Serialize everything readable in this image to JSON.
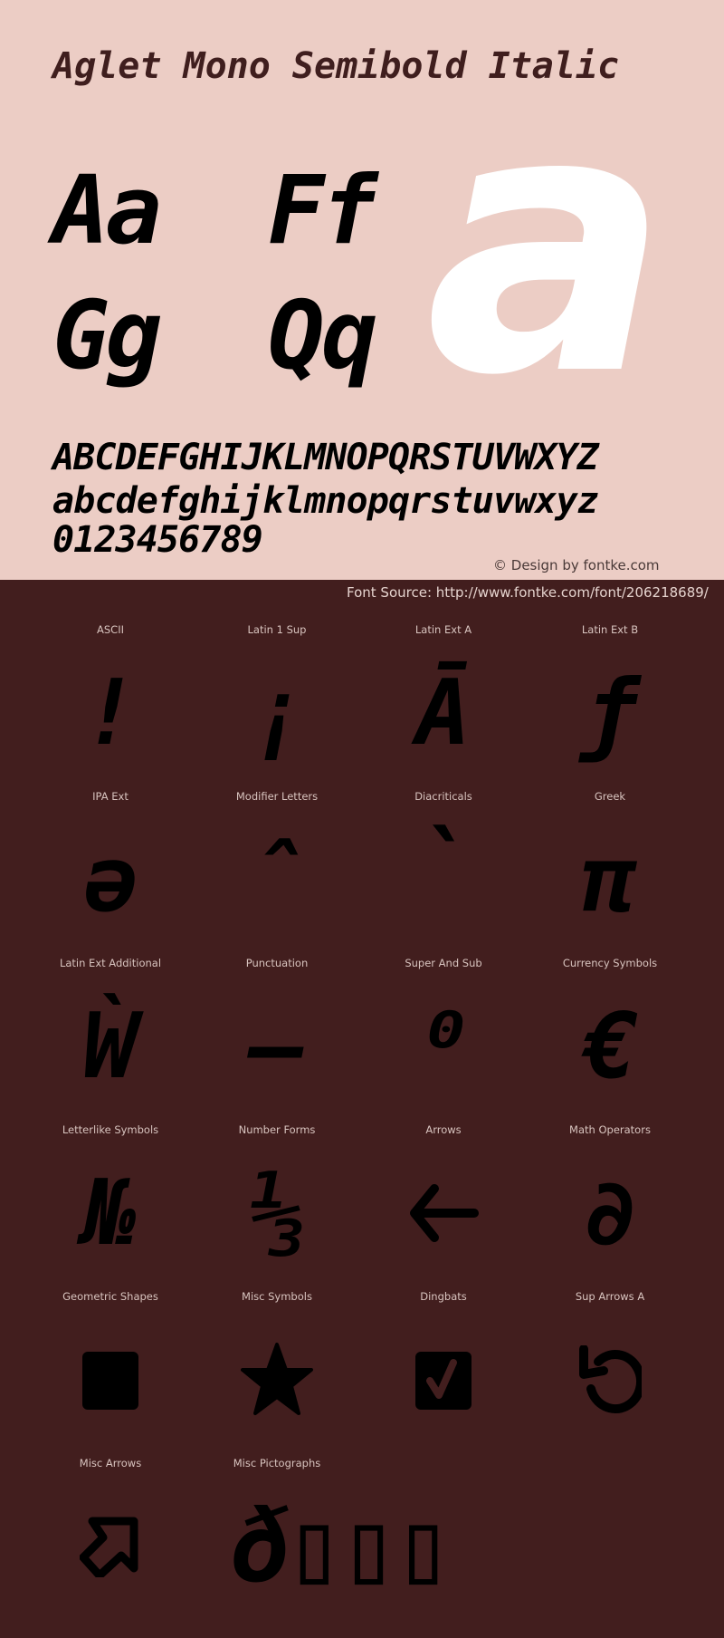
{
  "header": {
    "title": "Aglet Mono Semibold Italic"
  },
  "specimen": {
    "pairs": [
      "Aa",
      "Ff",
      "Gg",
      "Qq"
    ],
    "hero_glyph": "a",
    "uppercase": "ABCDEFGHIJKLMNOPQRSTUVWXYZ",
    "lowercase": "abcdefghijklmnopqrstuvwxyz",
    "digits": "0123456789",
    "credit": "© Design by fontke.com"
  },
  "source": {
    "text": "Font Source: http://www.fontke.com/font/206218689/"
  },
  "colors": {
    "top_background": "#eccdc5",
    "bottom_background": "#421e1e",
    "title_color": "#3f1e1e",
    "hero_color": "#ffffff",
    "glyph_color": "#000000"
  },
  "blocks": [
    {
      "label": "ASCII",
      "glyph": "!"
    },
    {
      "label": "Latin 1 Sup",
      "glyph": "¡"
    },
    {
      "label": "Latin Ext A",
      "glyph": "Ā"
    },
    {
      "label": "Latin Ext B",
      "glyph": "ƒ"
    },
    {
      "label": "IPA Ext",
      "glyph": "ə"
    },
    {
      "label": "Modifier Letters",
      "glyph": "ˆ"
    },
    {
      "label": "Diacriticals",
      "glyph": "̀"
    },
    {
      "label": "Greek",
      "glyph": "π"
    },
    {
      "label": "Latin Ext Additional",
      "glyph": "Ẁ"
    },
    {
      "label": "Punctuation",
      "glyph": "–"
    },
    {
      "label": "Super And Sub",
      "glyph": "⁰"
    },
    {
      "label": "Currency Symbols",
      "glyph": "€"
    },
    {
      "label": "Letterlike Symbols",
      "glyph": "№"
    },
    {
      "label": "Number Forms",
      "glyph": "⅓"
    },
    {
      "label": "Arrows",
      "glyph": "←"
    },
    {
      "label": "Math Operators",
      "glyph": "∂"
    },
    {
      "label": "Geometric Shapes",
      "glyph": "■"
    },
    {
      "label": "Misc Symbols",
      "glyph": "★"
    },
    {
      "label": "Dingbats",
      "glyph": "✔"
    },
    {
      "label": "Sup Arrows A",
      "glyph": "⟲"
    },
    {
      "label": "Misc Arrows",
      "glyph": "⬀"
    },
    {
      "label": "Misc Pictographs",
      "glyph": "ð▯▯▯"
    }
  ]
}
